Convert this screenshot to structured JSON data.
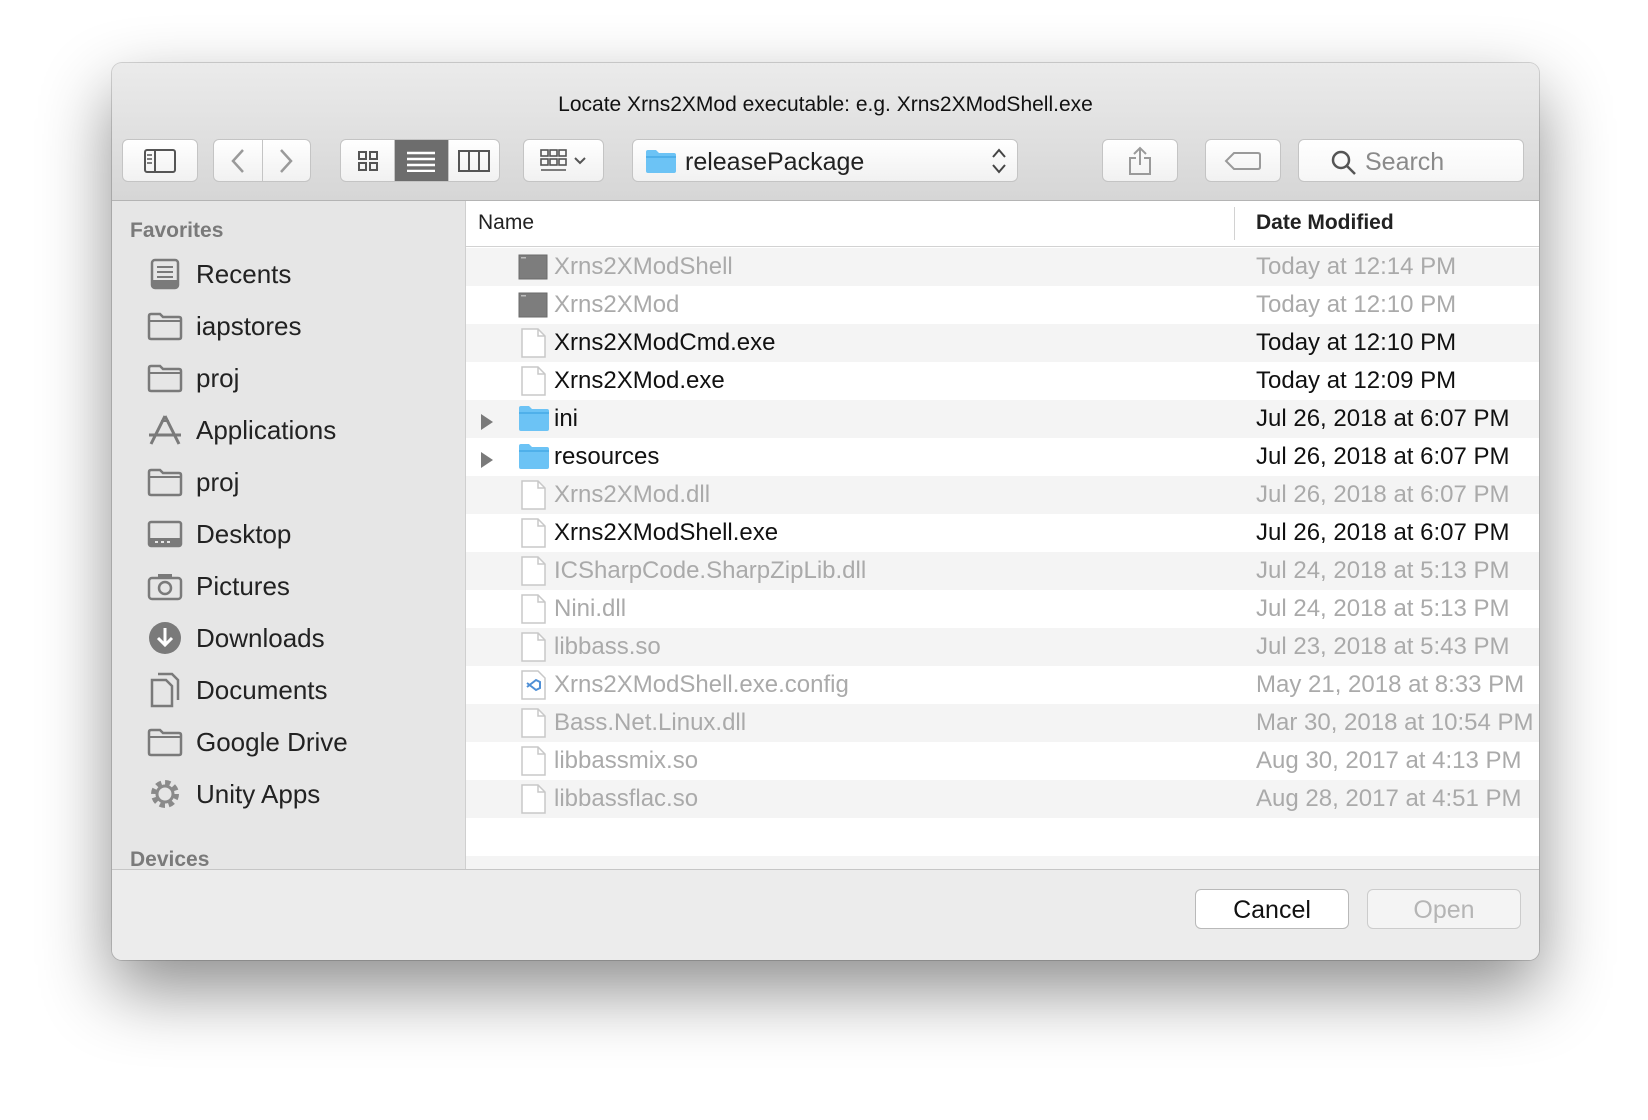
{
  "window": {
    "title": "Locate Xrns2XMod executable: e.g. Xrns2XModShell.exe"
  },
  "toolbar": {
    "path": "releasePackage",
    "search_placeholder": "Search"
  },
  "sidebar": {
    "favorites_heading": "Favorites",
    "devices_heading": "Devices",
    "items": [
      {
        "label": "Recents",
        "icon": "recents-icon"
      },
      {
        "label": "iapstores",
        "icon": "folder-icon"
      },
      {
        "label": "proj",
        "icon": "folder-icon"
      },
      {
        "label": "Applications",
        "icon": "applications-icon"
      },
      {
        "label": "proj",
        "icon": "folder-icon"
      },
      {
        "label": "Desktop",
        "icon": "desktop-icon"
      },
      {
        "label": "Pictures",
        "icon": "camera-icon"
      },
      {
        "label": "Downloads",
        "icon": "download-icon"
      },
      {
        "label": "Documents",
        "icon": "documents-icon"
      },
      {
        "label": "Google Drive",
        "icon": "folder-icon"
      },
      {
        "label": "Unity Apps",
        "icon": "gear-icon"
      }
    ]
  },
  "columns": {
    "name": "Name",
    "date": "Date Modified"
  },
  "files": [
    {
      "name": "Xrns2XModShell",
      "date": "Today at 12:14 PM",
      "kind": "exec",
      "enabled": false
    },
    {
      "name": "Xrns2XMod",
      "date": "Today at 12:10 PM",
      "kind": "exec",
      "enabled": false
    },
    {
      "name": "Xrns2XModCmd.exe",
      "date": "Today at 12:10 PM",
      "kind": "doc",
      "enabled": true
    },
    {
      "name": "Xrns2XMod.exe",
      "date": "Today at 12:09 PM",
      "kind": "doc",
      "enabled": true
    },
    {
      "name": "ini",
      "date": "Jul 26, 2018 at 6:07 PM",
      "kind": "folder",
      "enabled": true
    },
    {
      "name": "resources",
      "date": "Jul 26, 2018 at 6:07 PM",
      "kind": "folder",
      "enabled": true
    },
    {
      "name": "Xrns2XMod.dll",
      "date": "Jul 26, 2018 at 6:07 PM",
      "kind": "doc",
      "enabled": false
    },
    {
      "name": "Xrns2XModShell.exe",
      "date": "Jul 26, 2018 at 6:07 PM",
      "kind": "doc",
      "enabled": true
    },
    {
      "name": "ICSharpCode.SharpZipLib.dll",
      "date": "Jul 24, 2018 at 5:13 PM",
      "kind": "doc",
      "enabled": false
    },
    {
      "name": "Nini.dll",
      "date": "Jul 24, 2018 at 5:13 PM",
      "kind": "doc",
      "enabled": false
    },
    {
      "name": "libbass.so",
      "date": "Jul 23, 2018 at 5:43 PM",
      "kind": "doc",
      "enabled": false
    },
    {
      "name": "Xrns2XModShell.exe.config",
      "date": "May 21, 2018 at 8:33 PM",
      "kind": "config",
      "enabled": false
    },
    {
      "name": "Bass.Net.Linux.dll",
      "date": "Mar 30, 2018 at 10:54 PM",
      "kind": "doc",
      "enabled": false
    },
    {
      "name": "libbassmix.so",
      "date": "Aug 30, 2017 at 4:13 PM",
      "kind": "doc",
      "enabled": false
    },
    {
      "name": "libbassflac.so",
      "date": "Aug 28, 2017 at 4:51 PM",
      "kind": "doc",
      "enabled": false
    }
  ],
  "footer": {
    "cancel": "Cancel",
    "open": "Open"
  },
  "colors": {
    "folder": "#6cc3f5",
    "active_segment": "#6d6d6d",
    "dim_text": "#aaaaaa"
  }
}
